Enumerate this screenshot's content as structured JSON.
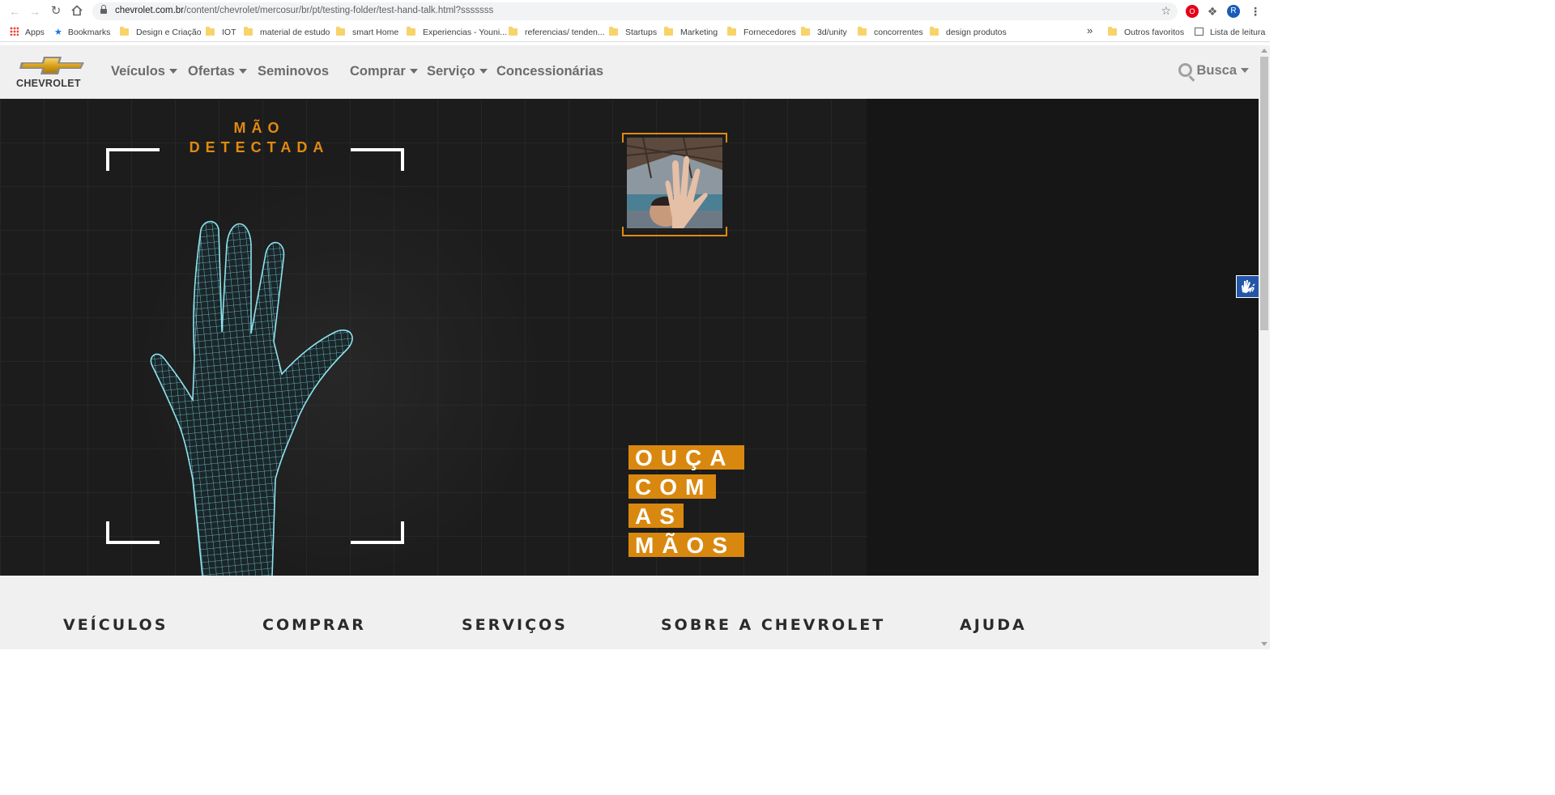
{
  "browser": {
    "url_host": "chevrolet.com.br",
    "url_path": "/content/chevrolet/mercosur/br/pt/testing-folder/test-hand-talk.html?sssssss",
    "profile_initial": "R",
    "bookmarks": [
      {
        "label": "Apps",
        "kind": "apps"
      },
      {
        "label": "Bookmarks",
        "kind": "star"
      },
      {
        "label": "Design e Criação",
        "kind": "folder"
      },
      {
        "label": "IOT",
        "kind": "folder"
      },
      {
        "label": "material de estudo",
        "kind": "folder"
      },
      {
        "label": "smart Home",
        "kind": "folder"
      },
      {
        "label": "Experiencias - Youni...",
        "kind": "folder"
      },
      {
        "label": "referencias/ tenden...",
        "kind": "folder"
      },
      {
        "label": "Startups",
        "kind": "folder"
      },
      {
        "label": "Marketing",
        "kind": "folder"
      },
      {
        "label": "Fornecedores",
        "kind": "folder"
      },
      {
        "label": "3d/unity",
        "kind": "folder"
      },
      {
        "label": "concorrentes",
        "kind": "folder"
      },
      {
        "label": "design produtos",
        "kind": "folder"
      }
    ],
    "overflow": "»",
    "other_bookmarks": "Outros favoritos",
    "reading_list": "Lista de leitura"
  },
  "header": {
    "logo_text": "CHEVROLET",
    "menu": [
      {
        "label": "Veículos",
        "dropdown": true
      },
      {
        "label": "Ofertas",
        "dropdown": true
      },
      {
        "label": "Seminovos",
        "dropdown": false
      },
      {
        "label": "Comprar",
        "dropdown": true
      },
      {
        "label": "Serviço",
        "dropdown": true
      },
      {
        "label": "Concessionárias",
        "dropdown": false
      }
    ],
    "search_label": "Busca"
  },
  "hero": {
    "detect_line1": "MÃO",
    "detect_line2": "DETECTADA",
    "tagline": [
      "OUÇA",
      "COM",
      "AS",
      "MÃOS"
    ],
    "accent_color": "#d9880f"
  },
  "footer": {
    "columns": [
      "VEÍCULOS",
      "COMPRAR",
      "SERVIÇOS",
      "SOBRE A CHEVROLET",
      "AJUDA"
    ]
  }
}
